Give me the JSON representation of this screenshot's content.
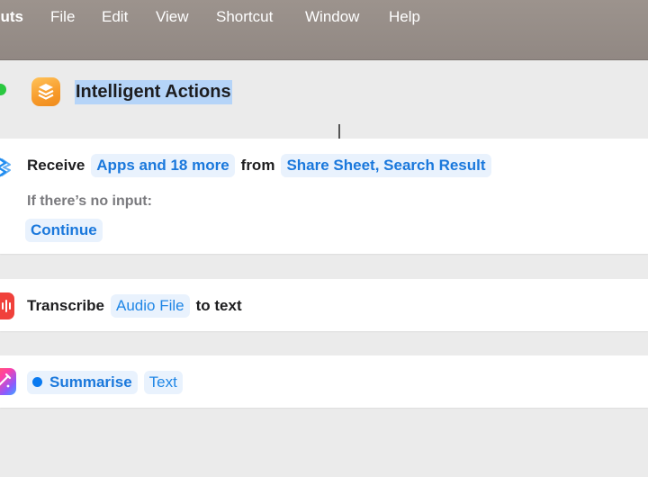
{
  "menubar": {
    "app_name": "cuts",
    "items": [
      "File",
      "Edit",
      "View",
      "Shortcut",
      "Window",
      "Help"
    ]
  },
  "window": {
    "title": "Intelligent Actions",
    "app_icon": "shortcuts-stack-icon"
  },
  "actions": {
    "receive": {
      "icon": "share-receive-icon",
      "verb": "Receive",
      "types_token": "Apps and 18 more",
      "from_word": "from",
      "sources_token": "Share Sheet, Search Result",
      "no_input_label": "If there’s no input:",
      "no_input_value": "Continue"
    },
    "transcribe": {
      "icon": "audio-waveform-icon",
      "verb": "Transcribe",
      "input_token": "Audio File",
      "suffix": "to text"
    },
    "summarise": {
      "icon": "apple-intelligence-icon",
      "verb_token": "Summarise",
      "input_token": "Text"
    }
  },
  "colors": {
    "menubar": "#968e89",
    "background": "#ebebeb",
    "token_text": "#1a78dc",
    "token_bg": "#e9f2fd",
    "selection": "#b5d4f8"
  }
}
